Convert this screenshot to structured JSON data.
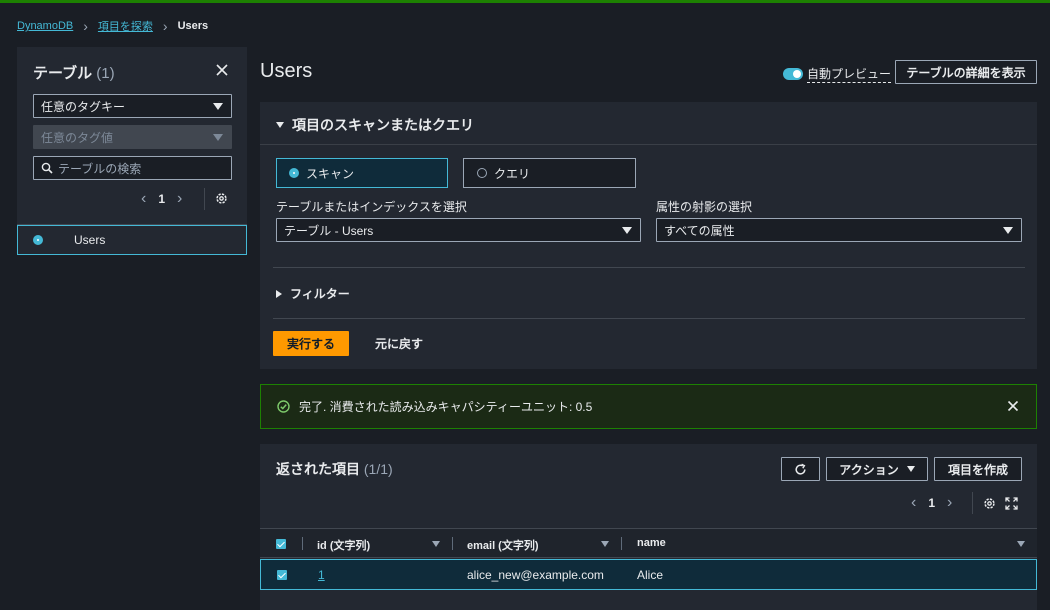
{
  "breadcrumb": {
    "root": "DynamoDB",
    "section": "項目を探索",
    "current": "Users"
  },
  "sidebar": {
    "title": "テーブル",
    "count": "(1)",
    "tag_key_select": "任意のタグキー",
    "tag_value_select": "任意のタグ値",
    "search_placeholder": "テーブルの検索",
    "page": "1",
    "tables": [
      {
        "name": "Users",
        "selected": true
      }
    ]
  },
  "main": {
    "title": "Users",
    "auto_preview_label": "自動プレビュー",
    "auto_preview_on": true,
    "details_button": "テーブルの詳細を表示",
    "scan_panel": {
      "heading": "項目のスキャンまたはクエリ",
      "scan_label": "スキャン",
      "query_label": "クエリ",
      "selected_mode": "scan",
      "table_index_label": "テーブルまたはインデックスを選択",
      "table_index_value": "テーブル - Users",
      "projection_label": "属性の射影の選択",
      "projection_value": "すべての属性",
      "filter_label": "フィルター",
      "run_button": "実行する",
      "reset_button": "元に戻す"
    },
    "alert": {
      "text": "完了. 消費された読み込みキャパシティーユニット: 0.5"
    },
    "results": {
      "heading": "返された項目",
      "count": "(1/1)",
      "actions_button": "アクション",
      "create_button": "項目を作成",
      "page": "1",
      "columns": [
        "id (文字列)",
        "email (文字列)",
        "name"
      ],
      "rows": [
        {
          "id": "1",
          "email": "alice_new@example.com",
          "name": "Alice",
          "checked": true
        }
      ]
    }
  },
  "colors": {
    "accent": "#44b9d6",
    "success": "#1d8102",
    "primary_button": "#ff9900",
    "background": "#1a1e25",
    "panel": "#232831"
  }
}
